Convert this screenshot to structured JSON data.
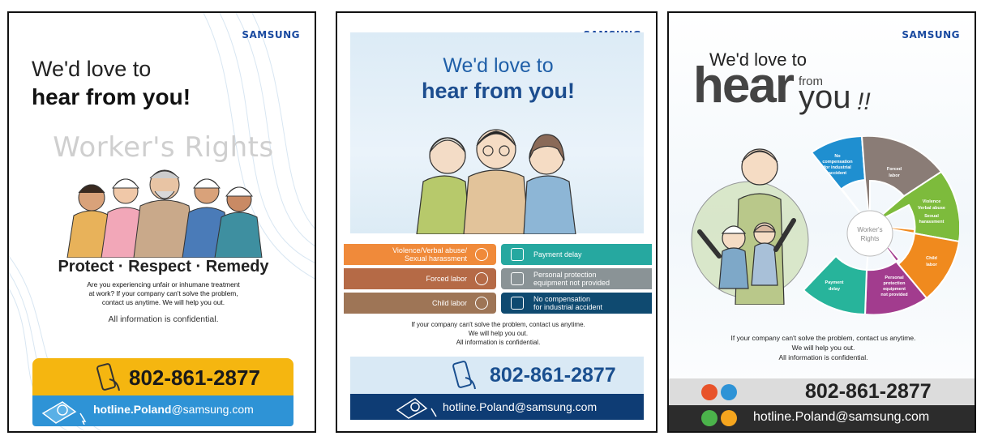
{
  "brand": "SAMSUNG",
  "poster1": {
    "headline_light": "We'd love to",
    "headline_bold": "hear from you!",
    "rights_title": "Worker's Rights",
    "tagline": "Protect · Respect · Remedy",
    "body_line1": "Are you experiencing unfair or inhumane treatment",
    "body_line2": "at work? If your company can't solve the problem,",
    "body_line3": "contact us anytime. We will help you out.",
    "confidential": "All information is confidential.",
    "phone": "802-861-2877",
    "email_bold": "hotline.Poland",
    "email_domain": "@samsung.com",
    "colors": {
      "yellow": "#f5b610",
      "blue": "#2e93d6"
    }
  },
  "poster2": {
    "headline_light": "We'd love to",
    "headline_bold": "hear from you!",
    "left_items": [
      {
        "line1": "Violence/Verbal abuse/",
        "line2": "Sexual harassment",
        "color": "#f08a3a"
      },
      {
        "line1": "Forced labor",
        "line2": "",
        "color": "#b56a46"
      },
      {
        "line1": "Child labor",
        "line2": "",
        "color": "#9e7556"
      }
    ],
    "right_items": [
      {
        "line1": "Payment delay",
        "line2": "",
        "color": "#26a8a0"
      },
      {
        "line1": "Personal protection",
        "line2": "equipment not provided",
        "color": "#8a9396"
      },
      {
        "line1": "No compensation",
        "line2": "for industrial accident",
        "color": "#0f4a70"
      }
    ],
    "body_line1": "If your company can't solve the problem, contact us anytime.",
    "body_line2": "We will help you out.",
    "body_line3": "All information is confidential.",
    "phone": "802-861-2877",
    "email_bold": "hotline.Poland",
    "email_domain": "@samsung.com"
  },
  "poster3": {
    "headline_light": "We'd love to",
    "hear": "hear",
    "from": "from",
    "you": "you",
    "exclaim": "!!",
    "center_label_1": "Worker's",
    "center_label_2": "Rights",
    "segments": [
      {
        "lines": [
          "No",
          "compensation",
          "for industrial",
          "accident"
        ],
        "color": "#1f8fd0"
      },
      {
        "lines": [
          "Forced",
          "labor"
        ],
        "color": "#8a7c76"
      },
      {
        "lines": [
          "Violence",
          "Verbal abuse",
          "Sexual",
          "harassment"
        ],
        "color": "#7dbb3c"
      },
      {
        "lines": [
          "Child",
          "labor"
        ],
        "color": "#f08a1e"
      },
      {
        "lines": [
          "Personal",
          "protection",
          "equipment",
          "not provided"
        ],
        "color": "#a23c8e"
      },
      {
        "lines": [
          "Payment",
          "delay"
        ],
        "color": "#27b49b"
      }
    ],
    "body_line1": "If your company can't solve the problem, contact us anytime.",
    "body_line2": "We will help you out.",
    "body_line3": "All information is confidential.",
    "phone": "802-861-2877",
    "email": "hotline.Poland@samsung.com"
  }
}
